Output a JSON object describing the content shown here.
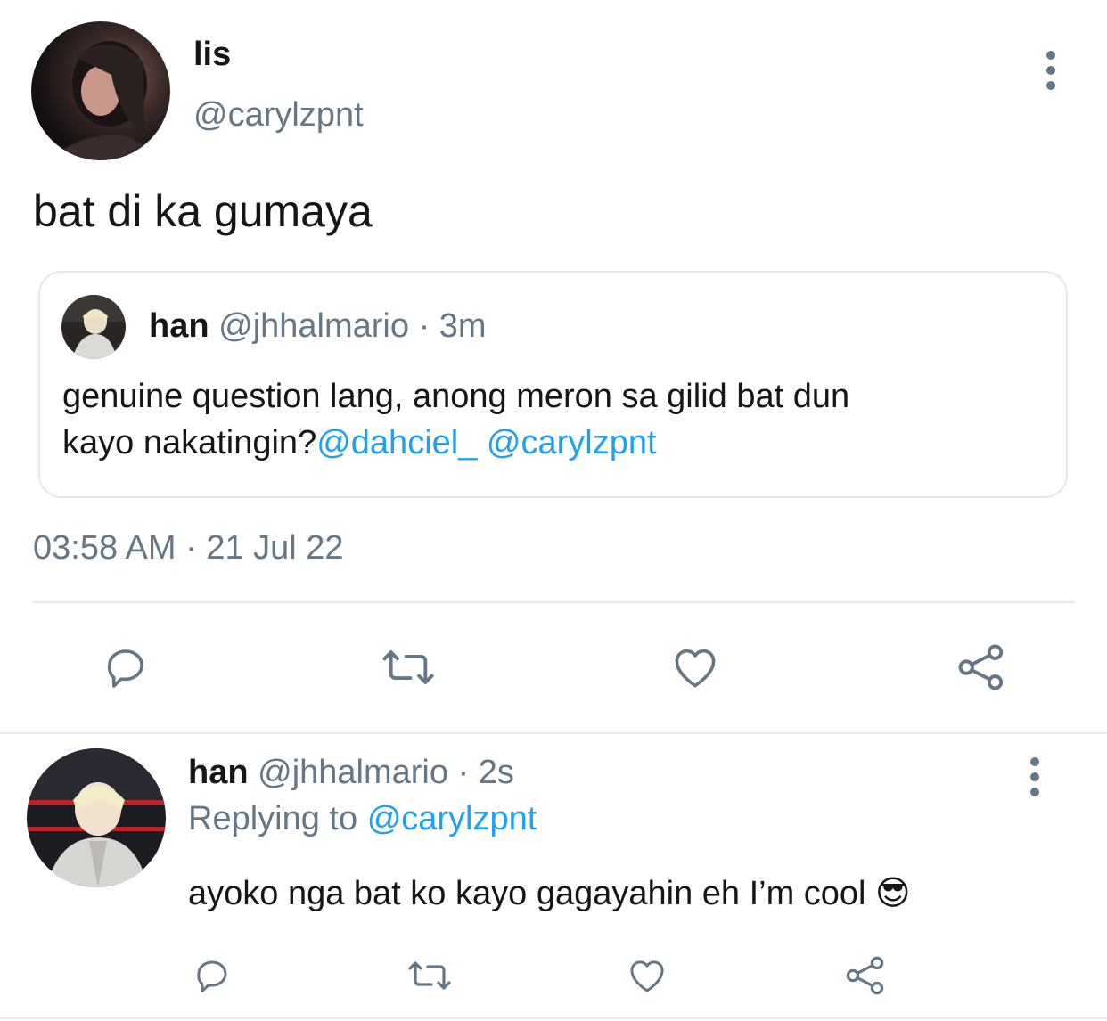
{
  "main_tweet": {
    "display_name": "lis",
    "handle": "@carylzpnt",
    "text": "bat di ka gumaya",
    "timestamp": "03:58 AM · 21 Jul 22"
  },
  "quoted_tweet": {
    "display_name": "han",
    "handle": "@jhhalmario",
    "time": "· 3m",
    "text_line1": "genuine question lang, anong meron sa gilid bat dun",
    "text_line2_prefix": "kayo nakatingin?",
    "mention1": "@dahciel_",
    "mention2": "@carylzpnt"
  },
  "reply_tweet": {
    "display_name": "han",
    "handle": "@jhhalmario",
    "time": "· 2s",
    "replying_label": "Replying to",
    "replying_handle": "@carylzpnt",
    "text": "ayoko nga bat ko kayo gagayahin eh I’m cool 😎"
  },
  "icons": {
    "reply": "comment-icon",
    "retweet": "retweet-icon",
    "like": "heart-icon",
    "share": "share-icon",
    "more": "more-vertical-icon"
  },
  "colors": {
    "link": "#1da1f2",
    "muted": "#657786",
    "divider": "#e6ecf0"
  }
}
